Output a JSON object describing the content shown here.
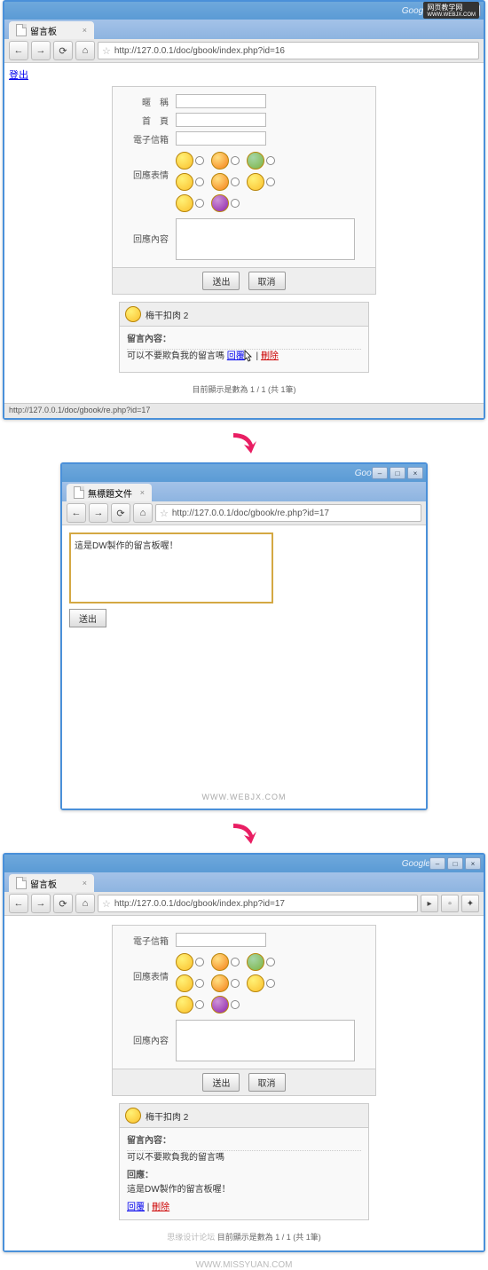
{
  "watermark_top": {
    "line1": "网页教学网",
    "line2": "WWW.WEBJX.COM"
  },
  "s1": {
    "tab_title": "留言板",
    "url": "http://127.0.0.1/doc/gbook/index.php?id=16",
    "logout_link": "登出",
    "form": {
      "label_nickname": "暱　稱",
      "label_homepage": "首　頁",
      "label_email": "電子信箱",
      "label_emotion": "回應表情",
      "label_content": "回應內容",
      "btn_submit": "送出",
      "btn_cancel": "取消"
    },
    "message": {
      "author": "梅干扣肉 2",
      "section_title": "留言內容：",
      "content_text": "可以不要欺負我的留言嗎",
      "reply_link": "回覆",
      "delete_link": "刪除"
    },
    "page_info": "目前顯示是數為 1 / 1 (共 1筆)",
    "status_url": "http://127.0.0.1/doc/gbook/re.php?id=17"
  },
  "s2": {
    "tab_title": "無標題文件",
    "url": "http://127.0.0.1/doc/gbook/re.php?id=17",
    "textarea_value": "這是DW製作的留言板喔！",
    "btn_submit": "送出"
  },
  "s3": {
    "tab_title": "留言板",
    "url": "http://127.0.0.1/doc/gbook/index.php?id=17",
    "form": {
      "label_email": "電子信箱",
      "label_emotion": "回應表情",
      "label_content": "回應內容",
      "btn_submit": "送出",
      "btn_cancel": "取消"
    },
    "message": {
      "author": "梅干扣肉 2",
      "section_title": "留言內容：",
      "content_text": "可以不要欺負我的留言嗎",
      "reply_title": "回應：",
      "reply_text": "這是DW製作的留言板喔！",
      "reply_link": "回覆",
      "delete_link": "刪除"
    },
    "page_info": "目前顯示是數為 1 / 1 (共 1筆)",
    "page_info_prefix": "思缘设计论坛"
  },
  "footer_watermark": "WWW.MISSYUAN.COM"
}
